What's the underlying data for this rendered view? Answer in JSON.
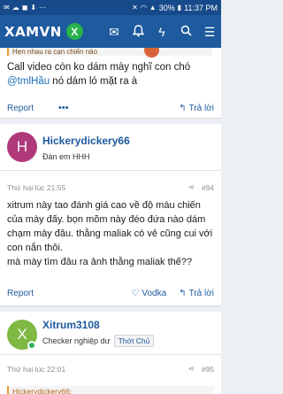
{
  "status_bar": {
    "battery": "30%",
    "time": "11:37 PM"
  },
  "header": {
    "logo_text": "XAMVN",
    "logo_badge": "X"
  },
  "posts": [
    {
      "quote_snippet": "Hẹn nhau ra cạn chiến nào",
      "message_mention": "@tmlHầu",
      "message_before": "Call video còn ko dám mày nghĩ con chó ",
      "message_after": " nó dám ló mặt ra à",
      "report_label": "Report",
      "more_label": "•••",
      "reply_label": "Trả lời"
    },
    {
      "username": "Hickerydickery66",
      "user_title": "Đàn em HHH",
      "avatar_letter": "H",
      "avatar_color": "#b0397a",
      "timestamp": "Thứ hai lúc 21:55",
      "post_number": "#94",
      "message": "xitrum này tao đánh giá cao về độ máu chiến của mày đấy. bọn mõm này đéo đứa nào dám chạm mày đâu. thằng maliak có vẻ cũng cui với con nắn thôi.\nmà mày tìm đâu ra ảnh thằng maliak thế??",
      "report_label": "Report",
      "like_label": "Vodka",
      "reply_label": "Trả lời"
    },
    {
      "username": "Xitrum3108",
      "user_title": "Checker nghiệp dư",
      "badge": "Thớt Chủ",
      "avatar_letter": "X",
      "avatar_color": "#7fb842",
      "timestamp": "Thứ hai lúc 22:01",
      "post_number": "#95",
      "quote_snippet": "Hickerydickery66:"
    }
  ],
  "colors": {
    "header_bg": "#1d5a9e",
    "status_bg": "#174a8a",
    "accent": "#1d5a9e"
  }
}
